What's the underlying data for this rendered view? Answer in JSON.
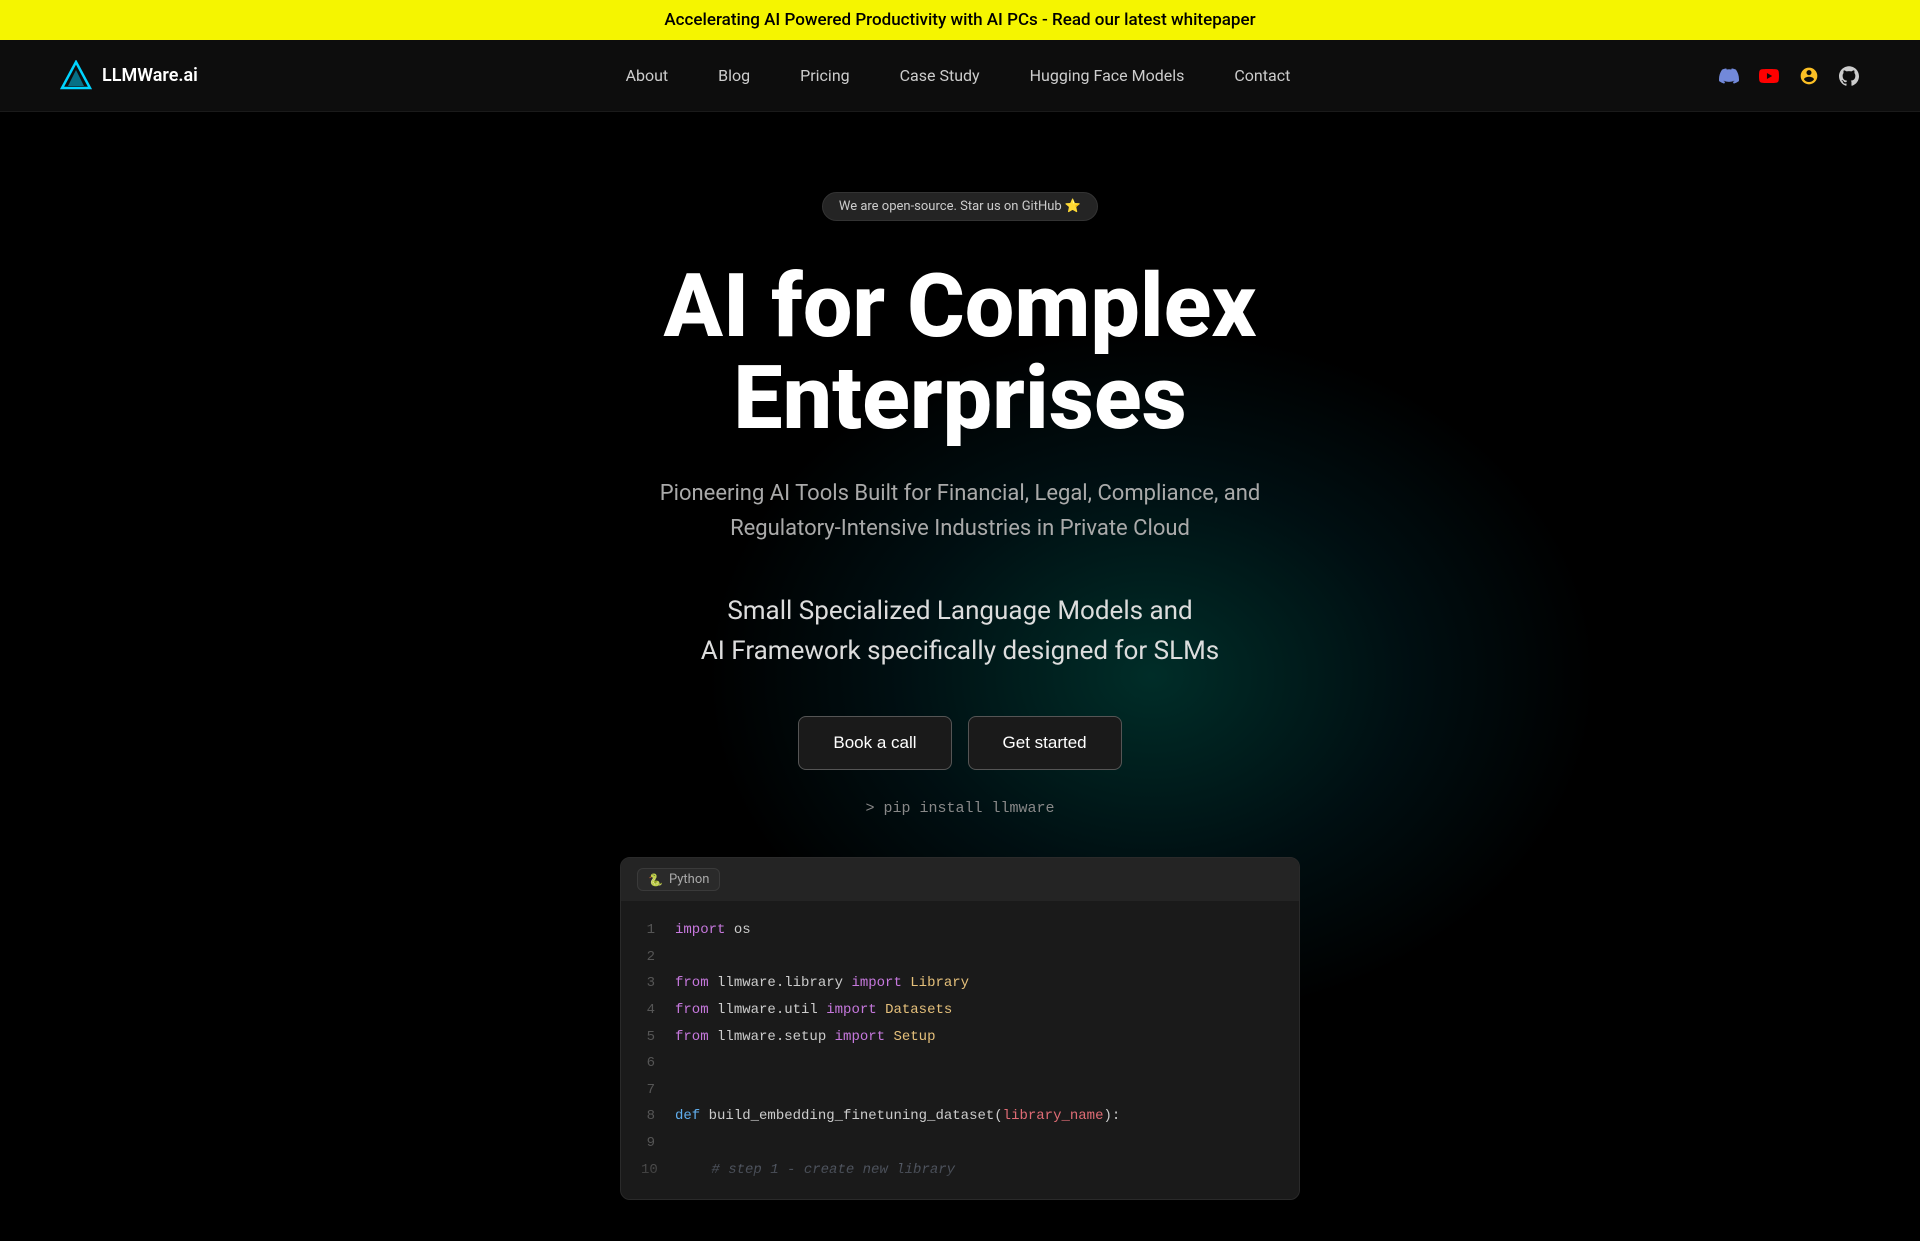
{
  "announcement": {
    "text": "Accelerating AI Powered Productivity with AI PCs - Read our latest whitepaper"
  },
  "navbar": {
    "logo_text": "LLMWare.ai",
    "nav_items": [
      {
        "label": "About",
        "href": "#"
      },
      {
        "label": "Blog",
        "href": "#"
      },
      {
        "label": "Pricing",
        "href": "#"
      },
      {
        "label": "Case Study",
        "href": "#"
      },
      {
        "label": "Hugging Face Models",
        "href": "#"
      },
      {
        "label": "Contact",
        "href": "#"
      }
    ],
    "icons": [
      {
        "name": "discord-icon",
        "symbol": "discord"
      },
      {
        "name": "youtube-icon",
        "symbol": "youtube"
      },
      {
        "name": "user-icon",
        "symbol": "user"
      },
      {
        "name": "github-icon",
        "symbol": "github"
      }
    ]
  },
  "hero": {
    "badge_text": "We are open-source. Star us on GitHub ⭐",
    "title": "AI for Complex Enterprises",
    "subtitle": "Pioneering AI Tools Built for Financial, Legal, Compliance, and Regulatory-Intensive Industries in Private Cloud",
    "tagline1": "Small Specialized Language Models and",
    "tagline2": "AI Framework specifically designed for SLMs",
    "btn_book": "Book a call",
    "btn_get_started": "Get started",
    "pip_install": "> pip install llmware"
  },
  "code_block": {
    "language": "Python",
    "lines": [
      {
        "num": "1",
        "content": "import os",
        "type": "import_os"
      },
      {
        "num": "2",
        "content": "",
        "type": "empty"
      },
      {
        "num": "3",
        "content": "from llmware.library import Library",
        "type": "from_import"
      },
      {
        "num": "4",
        "content": "from llmware.util import Datasets",
        "type": "from_import"
      },
      {
        "num": "5",
        "content": "from llmware.setup import Setup",
        "type": "from_import"
      },
      {
        "num": "6",
        "content": "",
        "type": "empty"
      },
      {
        "num": "7",
        "content": "",
        "type": "empty"
      },
      {
        "num": "8",
        "content": "def build_embedding_finetuning_dataset(library_name):",
        "type": "def"
      },
      {
        "num": "9",
        "content": "",
        "type": "empty"
      },
      {
        "num": "10",
        "content": "# step 1 - create new library",
        "type": "comment"
      }
    ]
  }
}
